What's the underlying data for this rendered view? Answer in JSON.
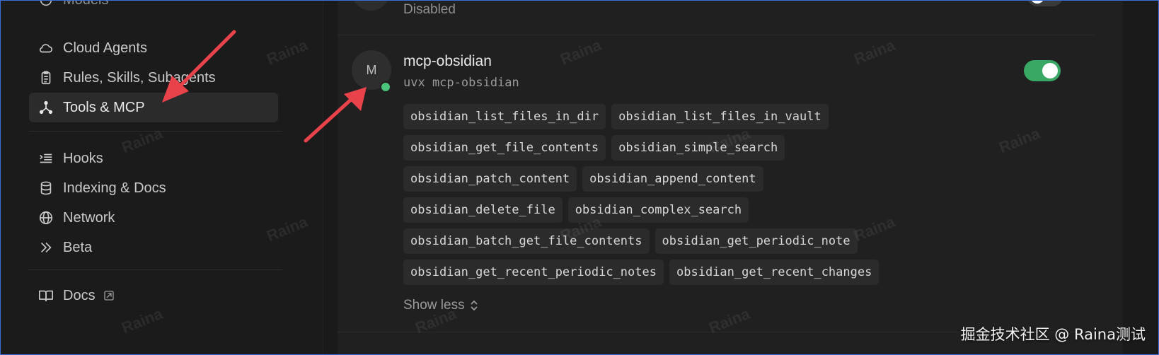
{
  "sidebar": {
    "top_partial_label": "Models",
    "items": [
      {
        "label": "Cloud Agents",
        "icon": "cloud-icon"
      },
      {
        "label": "Rules, Skills, Subagents",
        "icon": "clipboard-icon"
      },
      {
        "label": "Tools & MCP",
        "icon": "tools-icon",
        "active": true
      },
      {
        "label": "Hooks",
        "icon": "hooks-icon"
      },
      {
        "label": "Indexing & Docs",
        "icon": "database-icon"
      },
      {
        "label": "Network",
        "icon": "globe-icon"
      },
      {
        "label": "Beta",
        "icon": "double-chevron-icon"
      },
      {
        "label": "Docs",
        "icon": "book-icon"
      }
    ]
  },
  "previous_server": {
    "status": "Disabled",
    "enabled": false
  },
  "server": {
    "avatar_letter": "M",
    "name": "mcp-obsidian",
    "command": "uvx mcp-obsidian",
    "status_color": "#4cc37a",
    "enabled": true,
    "toggle_color": "#3aa865",
    "tools": [
      [
        "obsidian_list_files_in_dir",
        "obsidian_list_files_in_vault"
      ],
      [
        "obsidian_get_file_contents",
        "obsidian_simple_search"
      ],
      [
        "obsidian_patch_content",
        "obsidian_append_content"
      ],
      [
        "obsidian_delete_file",
        "obsidian_complex_search"
      ],
      [
        "obsidian_batch_get_file_contents",
        "obsidian_get_periodic_note"
      ],
      [
        "obsidian_get_recent_periodic_notes",
        "obsidian_get_recent_changes"
      ]
    ],
    "show_less_label": "Show less"
  },
  "annotation_color": "#e8434a",
  "watermark_text": "Raina",
  "brand_watermark": "掘金技术社区 @ Raina测试"
}
